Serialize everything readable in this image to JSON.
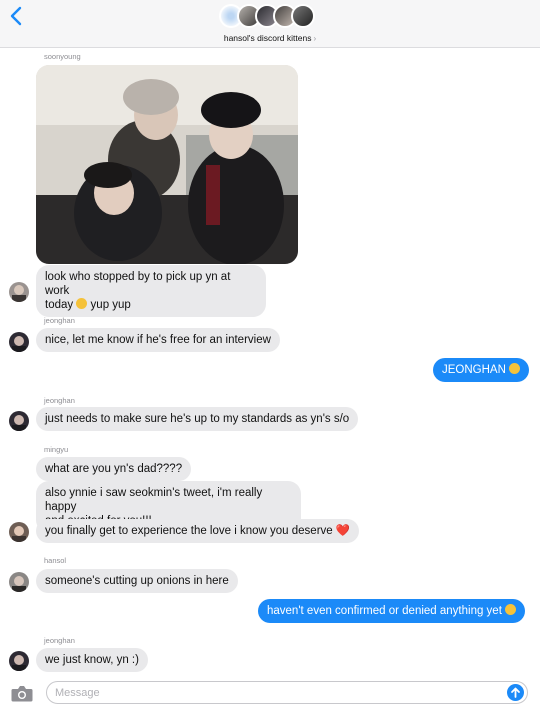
{
  "header": {
    "group_name": "hansol's discord kittens",
    "chevron": "›",
    "back_icon": "chevron-left-icon"
  },
  "messages": [
    {
      "sender": "soonyoung",
      "attachment": "photo"
    },
    {
      "text": "look who stopped by to pick up yn at work",
      "text2": "today",
      "text3": "yup yup"
    },
    {
      "sender": "jeonghan",
      "text": "nice, let me know if he's free for an interview"
    },
    {
      "text": "JEONGHAN",
      "outgoing": true
    },
    {
      "sender": "jeonghan",
      "text": "just needs to make sure he's up to my standards as yn's s/o"
    },
    {
      "sender": "mingyu",
      "text": "what are you yn's dad????"
    },
    {
      "text": "also ynnie i saw seokmin's tweet, i'm really happy",
      "text2": "and excited for you!!!"
    },
    {
      "text": "you finally get to experience the love i know you deserve",
      "emoji": "❤️"
    },
    {
      "sender": "hansol",
      "text": "someone's cutting up onions in here"
    },
    {
      "text": "haven't even confirmed or denied anything yet",
      "outgoing": true
    },
    {
      "sender": "jeonghan",
      "text": "we just know, yn :)"
    }
  ],
  "composer": {
    "placeholder": "Message"
  },
  "colors": {
    "accent": "#1b8af8",
    "incoming_bubble": "#e9e9eb",
    "header_bg": "#f6f6f7"
  }
}
